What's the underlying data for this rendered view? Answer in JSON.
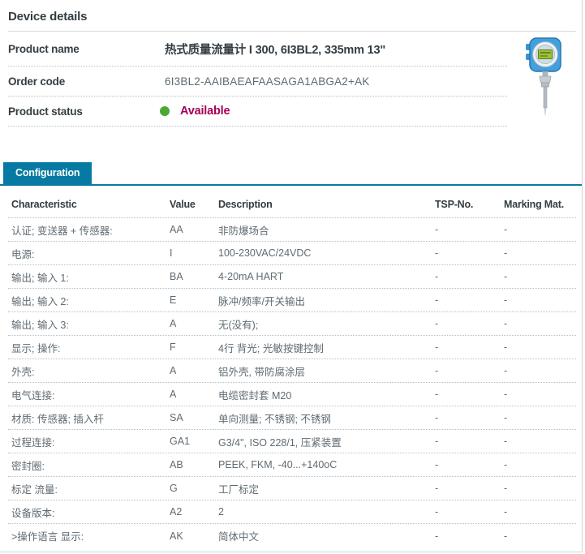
{
  "colors": {
    "accent_teal": "#077AA3",
    "status_green": "#4CA733",
    "status_magenta": "#A60057"
  },
  "device_details": {
    "title": "Device details",
    "product_name": {
      "label": "Product name",
      "value": "热式质量流量计 I 300, 6I3BL2, 335mm 13\""
    },
    "order_code": {
      "label": "Order code",
      "value": "6I3BL2-AAIBAEAFAASAGA1ABGA2+AK"
    },
    "product_status": {
      "label": "Product status",
      "value": "Available"
    }
  },
  "product_image": {
    "icon": "thermal-mass-flowmeter-icon"
  },
  "configuration": {
    "tab_label": "Configuration",
    "columns": [
      "Characteristic",
      "Value",
      "Description",
      "TSP-No.",
      "Marking Mat."
    ],
    "rows": [
      {
        "characteristic": "认证; 变送器 + 传感器:",
        "value": "AA",
        "description": "非防爆场合",
        "tsp_no": "-",
        "marking_mat": "-"
      },
      {
        "characteristic": "电源:",
        "value": "I",
        "description": "100-230VAC/24VDC",
        "tsp_no": "-",
        "marking_mat": "-"
      },
      {
        "characteristic": "输出; 输入 1:",
        "value": "BA",
        "description": "4-20mA HART",
        "tsp_no": "-",
        "marking_mat": "-"
      },
      {
        "characteristic": "输出; 输入 2:",
        "value": "E",
        "description": "脉冲/频率/开关输出",
        "tsp_no": "-",
        "marking_mat": "-"
      },
      {
        "characteristic": "输出; 输入 3:",
        "value": "A",
        "description": "无(没有);",
        "tsp_no": "-",
        "marking_mat": "-"
      },
      {
        "characteristic": "显示; 操作:",
        "value": "F",
        "description": "4行 背光; 光敏按键控制",
        "tsp_no": "-",
        "marking_mat": "-"
      },
      {
        "characteristic": "外壳:",
        "value": "A",
        "description": "铝外壳, 带防腐涂层",
        "tsp_no": "-",
        "marking_mat": "-"
      },
      {
        "characteristic": "电气连接:",
        "value": "A",
        "description": "电缆密封套 M20",
        "tsp_no": "-",
        "marking_mat": "-"
      },
      {
        "characteristic": "材质: 传感器; 插入杆",
        "value": "SA",
        "description": "单向测量; 不锈钢; 不锈钢",
        "tsp_no": "-",
        "marking_mat": "-"
      },
      {
        "characteristic": "过程连接:",
        "value": "GA1",
        "description": "G3/4\", ISO 228/1, 压紧装置",
        "tsp_no": "-",
        "marking_mat": "-"
      },
      {
        "characteristic": "密封圈:",
        "value": "AB",
        "description": "PEEK, FKM, -40...+140oC",
        "tsp_no": "-",
        "marking_mat": "-"
      },
      {
        "characteristic": "标定 流量:",
        "value": "G",
        "description": "工厂标定",
        "tsp_no": "-",
        "marking_mat": "-"
      },
      {
        "characteristic": "设备版本:",
        "value": "A2",
        "description": "2",
        "tsp_no": "-",
        "marking_mat": "-"
      },
      {
        "characteristic": ">操作语言 显示:",
        "value": "AK",
        "description": "简体中文",
        "tsp_no": "-",
        "marking_mat": "-"
      }
    ]
  }
}
